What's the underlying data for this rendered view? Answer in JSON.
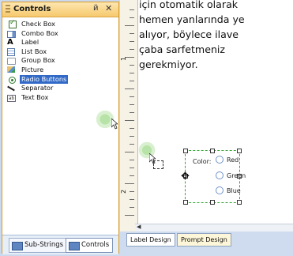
{
  "panel": {
    "title": "Controls",
    "pin_glyph": "й",
    "close_glyph": "✕",
    "items": [
      {
        "label": "Check Box",
        "icon": "checkbox-icon",
        "selected": false
      },
      {
        "label": "Combo Box",
        "icon": "combobox-icon",
        "selected": false
      },
      {
        "label": "Label",
        "icon": "label-icon",
        "selected": false
      },
      {
        "label": "List Box",
        "icon": "listbox-icon",
        "selected": false
      },
      {
        "label": "Group Box",
        "icon": "groupbox-icon",
        "selected": false
      },
      {
        "label": "Picture",
        "icon": "picture-icon",
        "selected": false
      },
      {
        "label": "Radio Buttons",
        "icon": "radio-icon",
        "selected": true
      },
      {
        "label": "Separator",
        "icon": "separator-icon",
        "selected": false
      },
      {
        "label": "Text Box",
        "icon": "textbox-icon",
        "selected": false
      }
    ],
    "tabs": {
      "sub_strings": "Sub-Strings",
      "controls": "Controls"
    }
  },
  "ruler": {
    "numbers": [
      "1",
      "2"
    ]
  },
  "description": {
    "lines": [
      "için otomatik olarak",
      "hemen yanlarında ye",
      "alıyor, böylece ilave",
      "çaba sarfetmeniz",
      "gerekmiyor."
    ]
  },
  "form": {
    "color_label": "Color:",
    "radios": [
      "Red",
      "Green",
      "Blue"
    ]
  },
  "design_tabs": {
    "label_design": "Label Design",
    "prompt_design": "Prompt Design"
  },
  "colors": {
    "selection": "#3169c6",
    "panel_header": "#f6c96d",
    "frame_border": "#3aa33a"
  }
}
